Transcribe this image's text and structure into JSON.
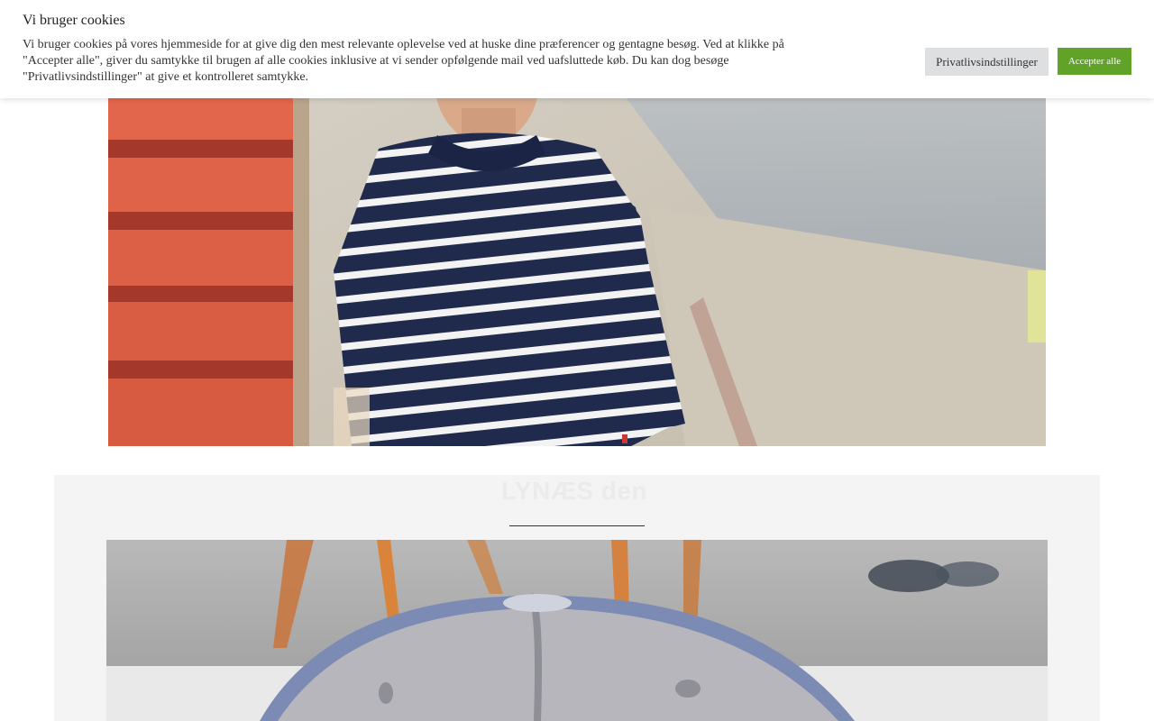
{
  "cookie_banner": {
    "title": "Vi bruger cookies",
    "text": "Vi bruger cookies på vores hjemmeside for at give dig den mest relevante oplevelse ved at huske dine præferencer og gentagne besøg. Ved at klikke på \"Accepter alle\", giver du samtykke til brugen af alle cookies inklusive at vi sender opfølgende mail ved uafsluttede køb. Du kan dog besøge \"Privatlivsindstillinger\" at give et kontrolleret samtykke.",
    "settings_label": "Privatlivsindstillinger",
    "accept_label": "Accepter alle",
    "accept_color": "#61a229",
    "settings_color": "#dedfe0"
  },
  "product": {
    "title": "LYNÆS den"
  }
}
